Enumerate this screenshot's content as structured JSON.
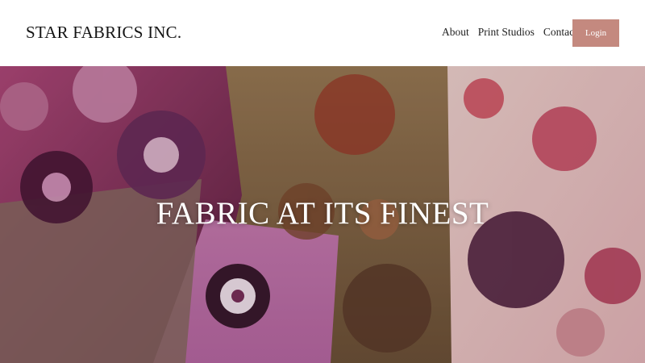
{
  "header": {
    "brand": "STAR FABRICS INC.",
    "nav": [
      {
        "label": "About"
      },
      {
        "label": "Print Studios"
      },
      {
        "label": "Contact"
      }
    ],
    "login_label": "Login",
    "login_color": "#c4897f"
  },
  "hero": {
    "title": "FABRIC AT ITS FINEST",
    "image": "floral-fabric-swatches"
  }
}
